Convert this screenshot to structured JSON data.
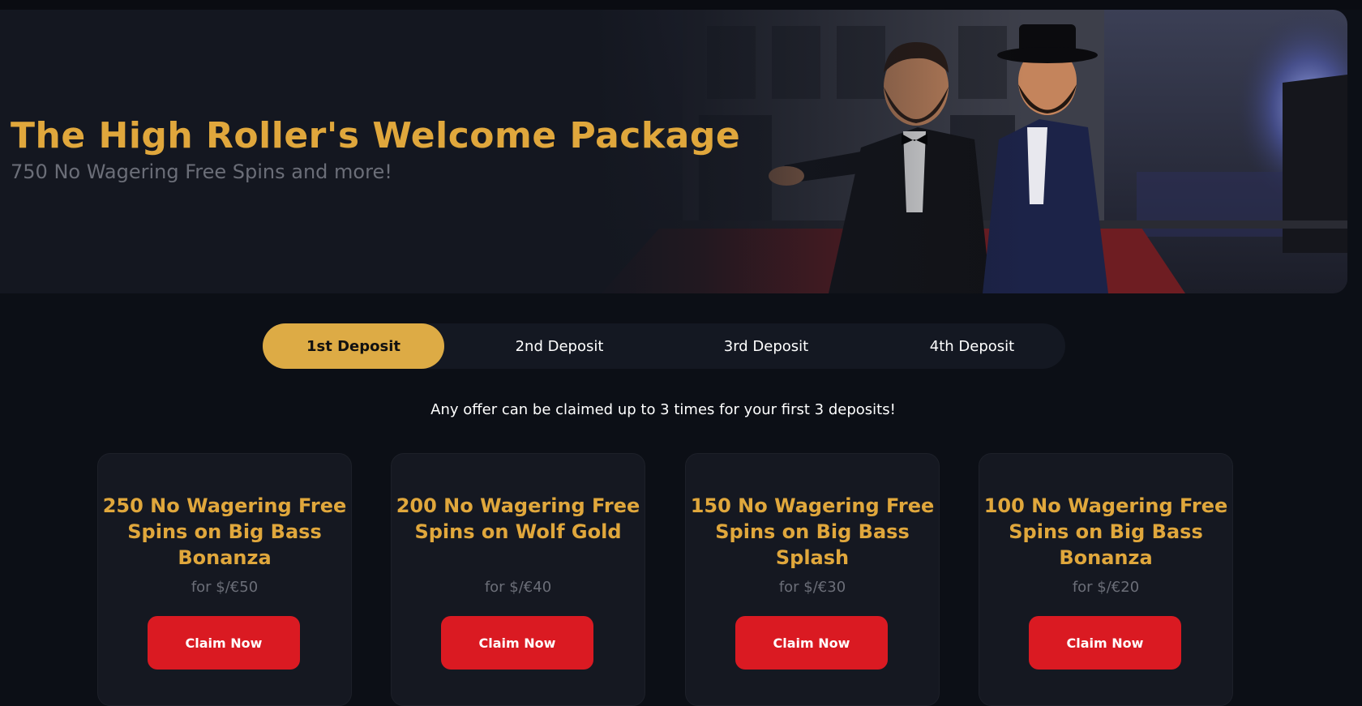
{
  "hero": {
    "title": "The High Roller's Welcome Package",
    "subtitle": "750 No Wagering Free Spins and more!",
    "accent_color": "#e0a73c"
  },
  "tabs": [
    {
      "label": "1st Deposit",
      "active": true
    },
    {
      "label": "2nd Deposit",
      "active": false
    },
    {
      "label": "3rd Deposit",
      "active": false
    },
    {
      "label": "4th Deposit",
      "active": false
    }
  ],
  "notice": "Any offer can be claimed up to 3 times for your first 3 deposits!",
  "offers": [
    {
      "title": "250 No Wagering Free Spins on Big Bass Bonanza",
      "price": "for $/€50",
      "button": "Claim Now"
    },
    {
      "title": "200 No Wagering Free Spins on Wolf Gold",
      "price": "for $/€40",
      "button": "Claim Now"
    },
    {
      "title": "150 No Wagering Free Spins on Big Bass Splash",
      "price": "for $/€30",
      "button": "Claim Now"
    },
    {
      "title": "100 No Wagering Free Spins on Big Bass Bonanza",
      "price": "for $/€20",
      "button": "Claim Now"
    }
  ],
  "colors": {
    "background": "#0c0f16",
    "tab_active": "#ddab45",
    "claim_button": "#da1a22"
  }
}
